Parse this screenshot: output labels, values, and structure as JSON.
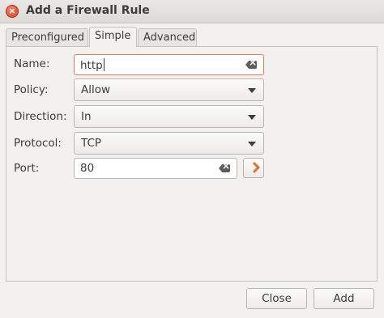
{
  "window": {
    "title": "Add a Firewall Rule",
    "close_glyph": "×"
  },
  "tabs": [
    {
      "label": "Preconfigured",
      "active": false
    },
    {
      "label": "Simple",
      "active": true
    },
    {
      "label": "Advanced",
      "active": false
    }
  ],
  "form": {
    "name": {
      "label": "Name:",
      "value": "http"
    },
    "policy": {
      "label": "Policy:",
      "value": "Allow"
    },
    "direction": {
      "label": "Direction:",
      "value": "In"
    },
    "protocol": {
      "label": "Protocol:",
      "value": "TCP"
    },
    "port": {
      "label": "Port:",
      "value": "80"
    }
  },
  "buttons": {
    "close": "Close",
    "add": "Add"
  },
  "colors": {
    "focus_border": "#f0774a",
    "accent": "#e36a1e",
    "close_button": "#e04f2f"
  }
}
